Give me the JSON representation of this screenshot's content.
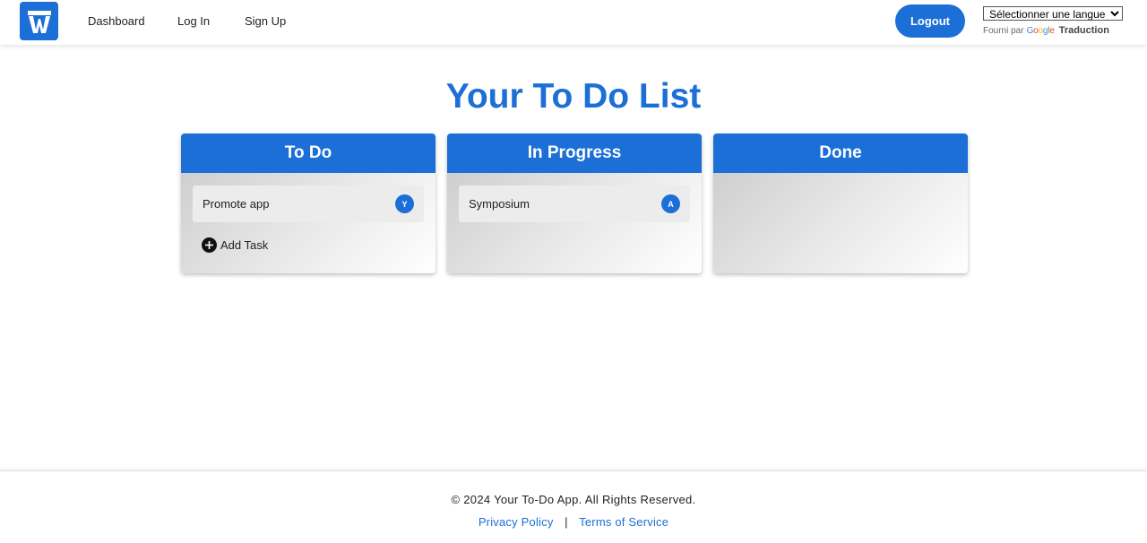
{
  "header": {
    "nav": {
      "dashboard": "Dashboard",
      "login": "Log In",
      "signup": "Sign Up"
    },
    "logout_label": "Logout",
    "language_select": {
      "selected": "Sélectionner une langue"
    },
    "powered_by": {
      "prefix": "Fourni par",
      "brand": "Google",
      "service": "Traduction"
    }
  },
  "page_title": "Your To Do List",
  "columns": [
    {
      "title": "To Do",
      "tasks": [
        {
          "text": "Promote app",
          "assignee_initial": "Y"
        }
      ],
      "add_task_label": "Add Task"
    },
    {
      "title": "In Progress",
      "tasks": [
        {
          "text": "Symposium",
          "assignee_initial": "A"
        }
      ]
    },
    {
      "title": "Done",
      "tasks": []
    }
  ],
  "footer": {
    "copyright": "© 2024 Your To-Do App. All Rights Reserved.",
    "privacy": "Privacy Policy",
    "separator": "|",
    "terms": "Terms of Service"
  },
  "colors": {
    "primary": "#1b6fd6",
    "column_gradient_dark": "#c9c9c9",
    "column_gradient_light": "#ffffff"
  },
  "icons": {
    "logo": "w-logo-icon",
    "add": "plus-circle-icon",
    "dropdown": "chevron-down-icon"
  }
}
